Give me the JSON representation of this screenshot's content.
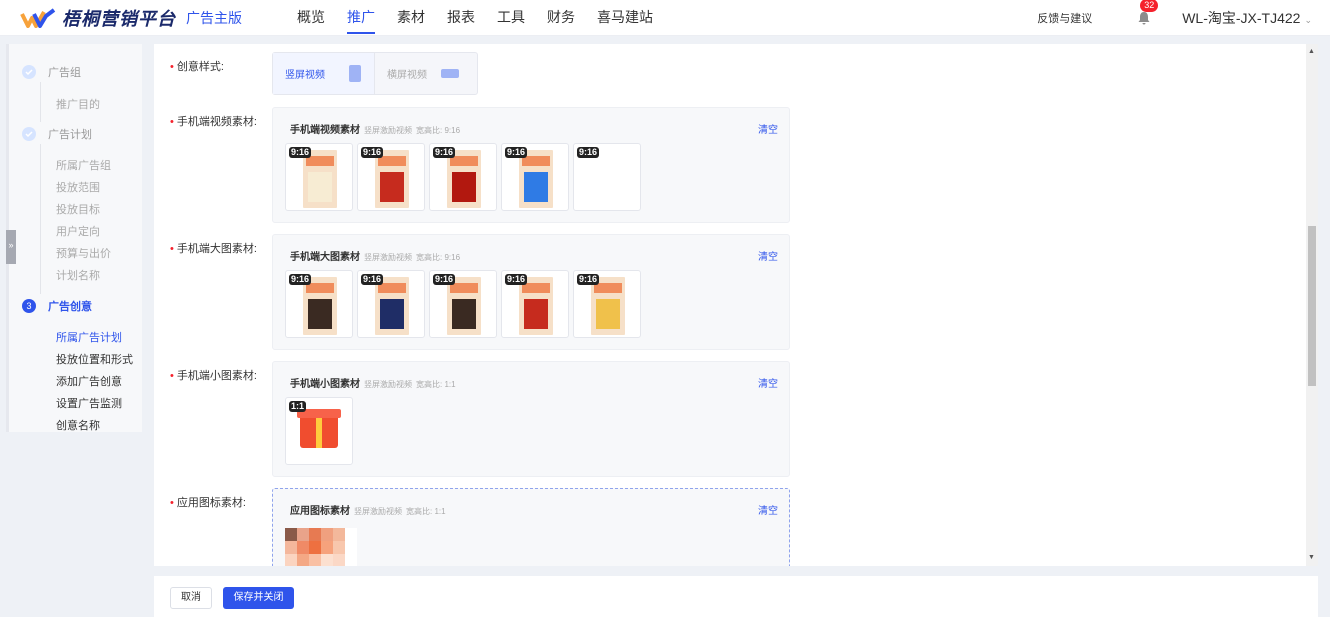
{
  "header": {
    "brand": "梧桐营销平台",
    "edition": "广告主版",
    "nav": [
      "概览",
      "推广",
      "素材",
      "报表",
      "工具",
      "财务",
      "喜马建站"
    ],
    "active_nav": "推广",
    "feedback": "反馈与建议",
    "notifications": "32",
    "account": "WL-淘宝-JX-TJ422",
    "account_caret": "⌄"
  },
  "sidebar": {
    "collapse": "»",
    "step1": {
      "label": "广告组",
      "items": [
        "推广目的"
      ]
    },
    "step2": {
      "label": "广告计划",
      "items": [
        "所属广告组",
        "投放范围",
        "投放目标",
        "用户定向",
        "预算与出价",
        "计划名称"
      ]
    },
    "step3": {
      "number": "3",
      "label": "广告创意",
      "items": [
        "所属广告计划",
        "投放位置和形式",
        "添加广告创意",
        "设置广告监测",
        "创意名称"
      ]
    }
  },
  "form": {
    "style_label": "创意样式:",
    "style_options": [
      "竖屏视频",
      "横屏视频"
    ],
    "clear": "清空",
    "sections": [
      {
        "label": "手机端视频素材:",
        "title": "手机端视频素材",
        "meta1": "竖屏激励视频",
        "meta2": "宽高比: 9:16",
        "tags": [
          "9:16",
          "9:16",
          "9:16",
          "9:16",
          "9:16"
        ]
      },
      {
        "label": "手机端大图素材:",
        "title": "手机端大图素材",
        "meta1": "竖屏激励视频",
        "meta2": "宽高比: 9:16",
        "tags": [
          "9:16",
          "9:16",
          "9:16",
          "9:16",
          "9:16"
        ]
      },
      {
        "label": "手机端小图素材:",
        "title": "手机端小图素材",
        "meta1": "竖屏激励视频",
        "meta2": "宽高比: 1:1",
        "tags": [
          "1:1"
        ]
      },
      {
        "label": "应用图标素材:",
        "title": "应用图标素材",
        "meta1": "竖屏激励视频",
        "meta2": "宽高比: 1:1",
        "tags": []
      }
    ]
  },
  "actions": {
    "cancel": "取消",
    "save": "保存并关闭"
  },
  "colors": {
    "primary": "#2f54eb",
    "required": "#f5222d"
  }
}
